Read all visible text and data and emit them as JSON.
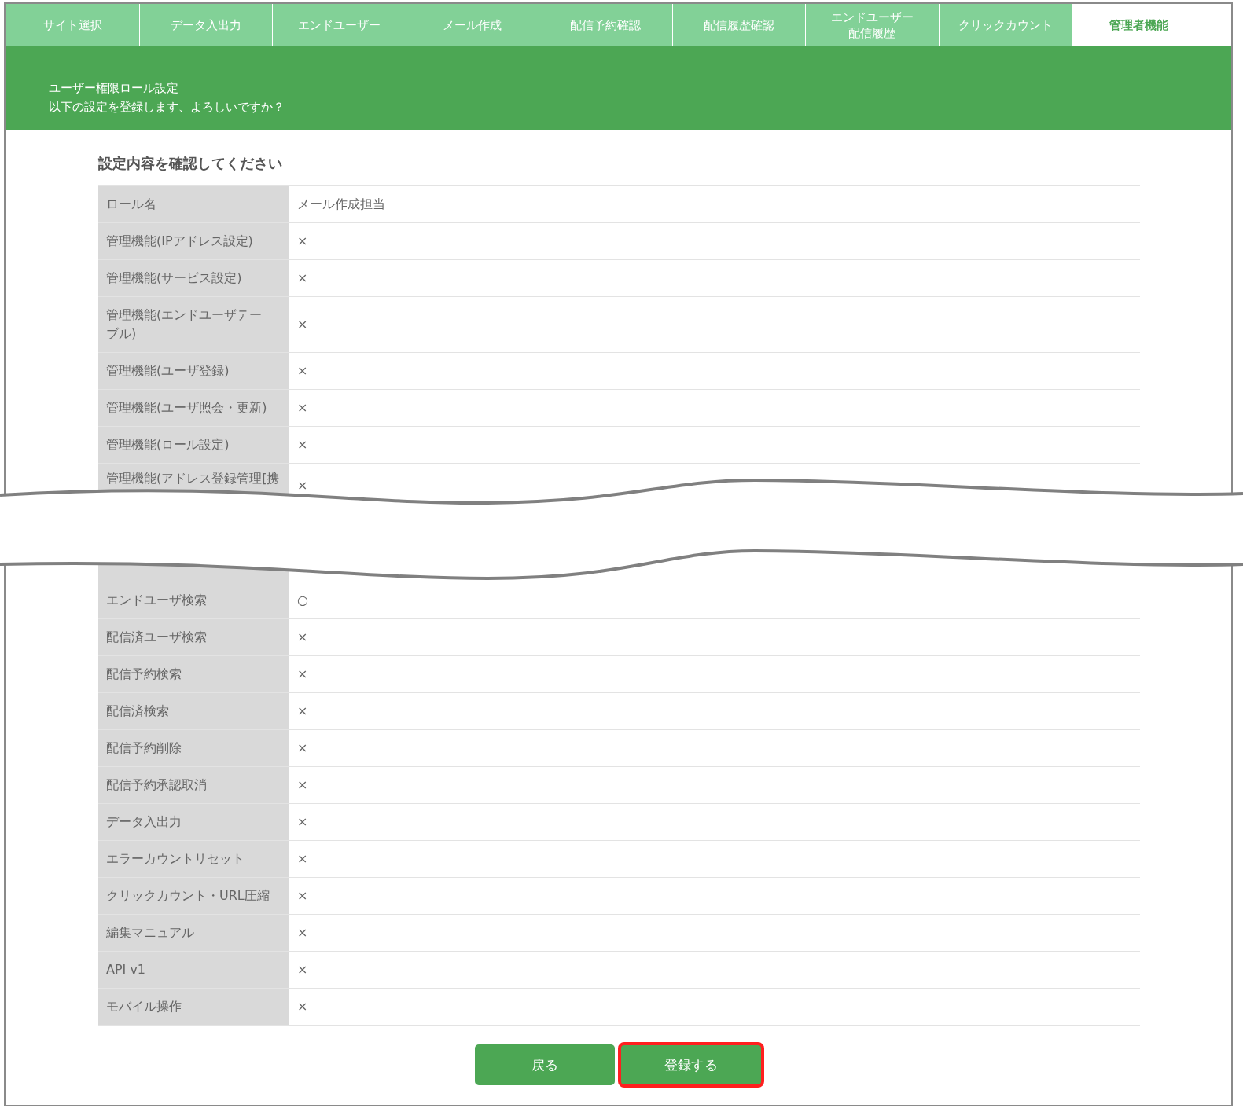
{
  "tabs": [
    {
      "label": "サイト選択",
      "selected": false
    },
    {
      "label": "データ入出力",
      "selected": false
    },
    {
      "label": "エンドユーザー",
      "selected": false
    },
    {
      "label": "メール作成",
      "selected": false
    },
    {
      "label": "配信予約確認",
      "selected": false
    },
    {
      "label": "配信履歴確認",
      "selected": false
    },
    {
      "label": "エンドユーザー",
      "label_line_2": "配信履歴",
      "selected": false
    },
    {
      "label": "クリックカウント",
      "selected": false
    },
    {
      "label": "管理者機能",
      "selected": true
    }
  ],
  "header": {
    "title": "ユーザー権限ロール設定",
    "message": "以下の設定を登録します、よろしいですか？"
  },
  "section_title": "設定内容を確認してください",
  "table": {
    "rows_top": [
      {
        "label": "ロール名",
        "value": "メール作成担当"
      },
      {
        "label": "管理機能(IPアドレス設定)",
        "value": "×"
      },
      {
        "label": "管理機能(サービス設定)",
        "value": "×"
      },
      {
        "label": "管理機能(エンドユーザテーブル)",
        "value": "×"
      },
      {
        "label": "管理機能(ユーザ登録)",
        "value": "×"
      },
      {
        "label": "管理機能(ユーザ照会・更新)",
        "value": "×"
      },
      {
        "label": "管理機能(ロール設定)",
        "value": "×"
      }
    ],
    "cut_before": {
      "label": "管理機能(アドレス登録管理[携",
      "value": "×"
    },
    "rows_bottom": [
      {
        "label": "エンドユーザ検索",
        "value": "○"
      },
      {
        "label": "配信済ユーザ検索",
        "value": "×"
      },
      {
        "label": "配信予約検索",
        "value": "×"
      },
      {
        "label": "配信済検索",
        "value": "×"
      },
      {
        "label": "配信予約削除",
        "value": "×"
      },
      {
        "label": "配信予約承認取消",
        "value": "×"
      },
      {
        "label": "データ入出力",
        "value": "×"
      },
      {
        "label": "エラーカウントリセット",
        "value": "×"
      },
      {
        "label": "クリックカウント・URL圧縮",
        "value": "×"
      },
      {
        "label": "編集マニュアル",
        "value": "×"
      },
      {
        "label": "API v1",
        "value": "×"
      },
      {
        "label": "モバイル操作",
        "value": "×"
      }
    ]
  },
  "buttons": [
    {
      "label": "戻る",
      "highlighted": false
    },
    {
      "label": "登録する",
      "highlighted": true
    }
  ]
}
